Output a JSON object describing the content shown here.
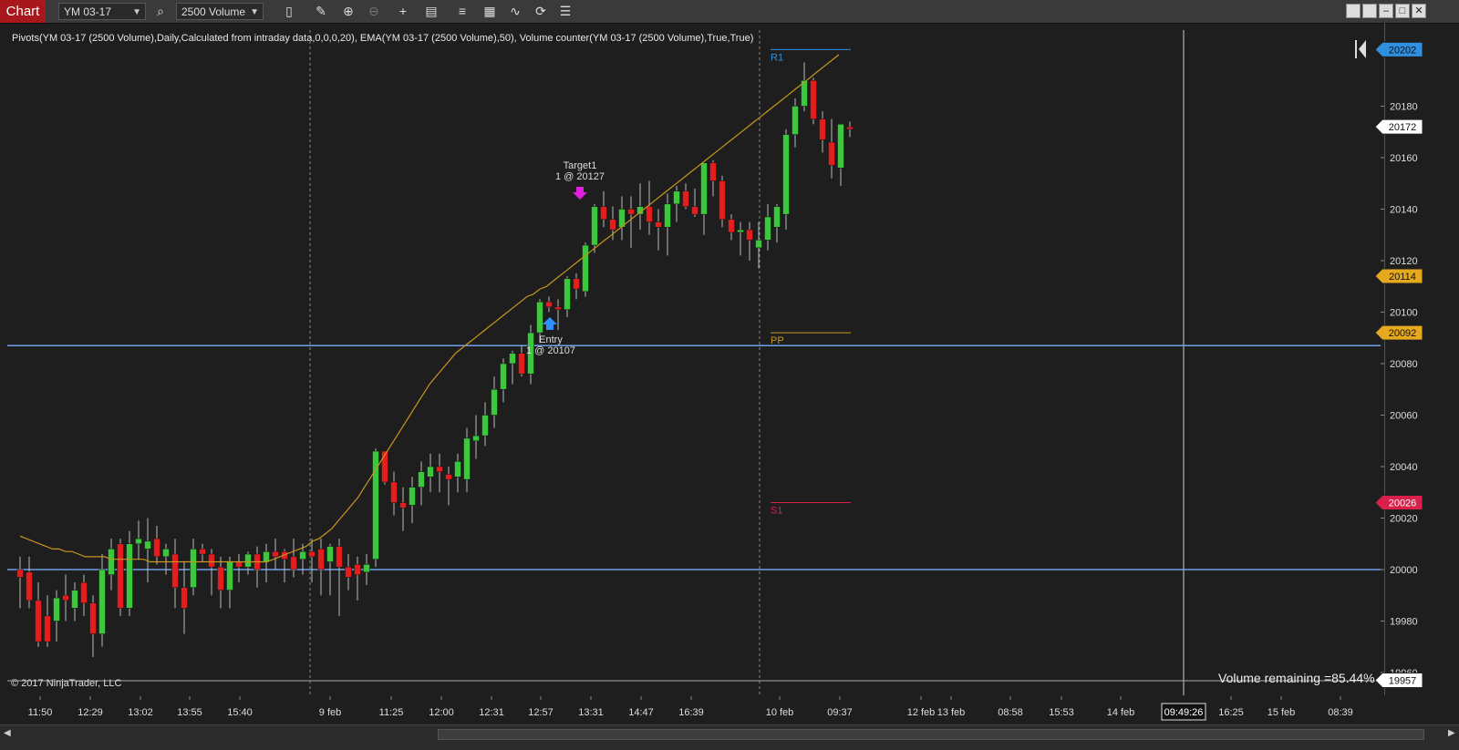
{
  "toolbar": {
    "chart_tab": "Chart",
    "instrument": "YM 03-17",
    "bar_type": "2500 Volume"
  },
  "indicator_label": "Pivots(YM 03-17 (2500 Volume),Daily,Calculated from intraday data,0,0,0,20), EMA(YM 03-17 (2500 Volume),50), Volume counter(YM 03-17 (2500 Volume),True,True)",
  "copyright": "© 2017 NinjaTrader, LLC",
  "volume_remaining": "Volume remaining =85.44%",
  "pivots": {
    "r1": "R1",
    "pp": "PP",
    "s1": "S1"
  },
  "annotations": {
    "target_title": "Target1",
    "target_detail": "1 @ 20127",
    "entry_title": "Entry",
    "entry_detail": "1 @ 20107"
  },
  "colors": {
    "up_candle": "#3cc83c",
    "down_candle": "#e41e1e",
    "ema": "#c8961e",
    "r1": "#2f8fe0",
    "pp": "#c8961e",
    "s1": "#d8204a",
    "hline": "#6fa0e8"
  },
  "chart_data": {
    "type": "candlestick",
    "y_ticks": [
      19960,
      19980,
      20000,
      20020,
      20040,
      20060,
      20080,
      20100,
      20120,
      20140,
      20160,
      20180
    ],
    "price_tags": [
      {
        "label": "20202",
        "color": "#2f8fe0"
      },
      {
        "label": "20172",
        "color": "#ffffff"
      },
      {
        "label": "20114",
        "color": "#e6a81c"
      },
      {
        "label": "20092",
        "color": "#e6a81c"
      },
      {
        "label": "20026",
        "color": "#d8204a"
      },
      {
        "label": "19957",
        "color": "#ffffff"
      }
    ],
    "x_ticks": [
      "11:50",
      "12:29",
      "13:02",
      "13:55",
      "15:40",
      "9 feb",
      "11:25",
      "12:00",
      "12:31",
      "12:57",
      "13:31",
      "14:47",
      "16:39",
      "10 feb",
      "09:37",
      "12 feb",
      "13 feb",
      "08:58",
      "15:53",
      "14 feb",
      "09:49:26",
      "16:25",
      "15 feb",
      "08:39"
    ],
    "highlighted_x_tick": "09:49:26",
    "horizontal_lines": [
      20087,
      20000
    ],
    "pivot_levels": {
      "r1": 20202,
      "pp": 20092,
      "s1": 20026
    },
    "candles": [
      [
        20000,
        20005,
        19985,
        19997
      ],
      [
        19999,
        20005,
        19985,
        19988
      ],
      [
        19988,
        19995,
        19970,
        19972
      ],
      [
        19982,
        19990,
        19970,
        19972
      ],
      [
        19980,
        19992,
        19972,
        19989
      ],
      [
        19990,
        19998,
        19980,
        19988
      ],
      [
        19985,
        19995,
        19980,
        19992
      ],
      [
        19995,
        19998,
        19982,
        19987
      ],
      [
        19987,
        19990,
        19966,
        19975
      ],
      [
        19975,
        20006,
        19970,
        20000
      ],
      [
        19998,
        20012,
        19992,
        20008
      ],
      [
        20010,
        20012,
        19982,
        19985
      ],
      [
        19985,
        20015,
        19982,
        20010
      ],
      [
        20010,
        20019,
        20004,
        20012
      ],
      [
        20008,
        20020,
        19995,
        20011
      ],
      [
        20012,
        20017,
        20002,
        20005
      ],
      [
        20005,
        20010,
        19998,
        20008
      ],
      [
        20006,
        20012,
        19985,
        19993
      ],
      [
        19993,
        20003,
        19975,
        19985
      ],
      [
        19993,
        20012,
        19990,
        20008
      ],
      [
        20008,
        20010,
        20003,
        20006
      ],
      [
        20006,
        20008,
        19990,
        20001
      ],
      [
        20001,
        20005,
        19985,
        19992
      ],
      [
        19992,
        20005,
        19985,
        20003
      ],
      [
        20003,
        20006,
        19995,
        20001
      ],
      [
        20001,
        20007,
        19998,
        20006
      ],
      [
        20006,
        20009,
        19993,
        20000
      ],
      [
        20003,
        20010,
        19995,
        20007
      ],
      [
        20007,
        20012,
        20000,
        20005
      ],
      [
        20007,
        20008,
        19995,
        20004
      ],
      [
        20005,
        20012,
        19997,
        20000
      ],
      [
        20004,
        20010,
        19998,
        20007
      ],
      [
        20007,
        20012,
        19995,
        20005
      ],
      [
        20008,
        20012,
        19990,
        20000
      ],
      [
        20003,
        20010,
        19990,
        20009
      ],
      [
        20009,
        20012,
        19982,
        20001
      ],
      [
        20001,
        20006,
        19992,
        19997
      ],
      [
        20002,
        20005,
        19988,
        19998
      ],
      [
        19999,
        20006,
        19994,
        20002
      ],
      [
        20004,
        20047,
        20001,
        20046
      ],
      [
        20046,
        20046,
        20033,
        20034
      ],
      [
        20034,
        20038,
        20021,
        20026
      ],
      [
        20026,
        20032,
        20015,
        20024
      ],
      [
        20025,
        20036,
        20018,
        20032
      ],
      [
        20032,
        20042,
        20025,
        20038
      ],
      [
        20036,
        20045,
        20030,
        20040
      ],
      [
        20040,
        20045,
        20030,
        20038
      ],
      [
        20037,
        20040,
        20025,
        20035
      ],
      [
        20036,
        20045,
        20030,
        20042
      ],
      [
        20035,
        20055,
        20030,
        20051
      ],
      [
        20050,
        20060,
        20043,
        20052
      ],
      [
        20052,
        20065,
        20048,
        20060
      ],
      [
        20060,
        20075,
        20055,
        20070
      ],
      [
        20070,
        20082,
        20065,
        20080
      ],
      [
        20080,
        20085,
        20072,
        20084
      ],
      [
        20084,
        20087,
        20075,
        20076
      ],
      [
        20076,
        20095,
        20072,
        20092
      ],
      [
        20092,
        20105,
        20088,
        20104
      ],
      [
        20104,
        20106,
        20100,
        20102
      ],
      [
        20102,
        20105,
        20093,
        20101
      ],
      [
        20101,
        20114,
        20098,
        20113
      ],
      [
        20113,
        20115,
        20105,
        20109
      ],
      [
        20108,
        20127,
        20106,
        20126
      ],
      [
        20126,
        20142,
        20123,
        20141
      ],
      [
        20141,
        20147,
        20133,
        20136
      ],
      [
        20136,
        20141,
        20128,
        20132
      ],
      [
        20133,
        20145,
        20128,
        20140
      ],
      [
        20140,
        20145,
        20125,
        20138
      ],
      [
        20138,
        20150,
        20132,
        20141
      ],
      [
        20141,
        20151,
        20130,
        20135
      ],
      [
        20135,
        20140,
        20124,
        20133
      ],
      [
        20133,
        20146,
        20122,
        20142
      ],
      [
        20142,
        20149,
        20135,
        20147
      ],
      [
        20147,
        20150,
        20140,
        20141
      ],
      [
        20141,
        20148,
        20137,
        20138
      ],
      [
        20138,
        20158,
        20130,
        20158
      ],
      [
        20158,
        20159,
        20145,
        20151
      ],
      [
        20151,
        20153,
        20133,
        20136
      ],
      [
        20136,
        20138,
        20128,
        20131
      ],
      [
        20131,
        20135,
        20122,
        20132
      ],
      [
        20132,
        20135,
        20120,
        20128
      ],
      [
        20125,
        20135,
        20117,
        20128
      ],
      [
        20128,
        20142,
        20124,
        20137
      ],
      [
        20133,
        20142,
        20127,
        20141
      ],
      [
        20138,
        20171,
        20132,
        20169
      ],
      [
        20169,
        20183,
        20164,
        20180
      ],
      [
        20180,
        20197,
        20178,
        20190
      ],
      [
        20190,
        20191,
        20173,
        20175
      ],
      [
        20175,
        20178,
        20162,
        20167
      ],
      [
        20166,
        20175,
        20152,
        20157
      ],
      [
        20156,
        20173,
        20149,
        20173
      ],
      [
        20172,
        20174,
        20168,
        20171
      ]
    ],
    "ema": [
      20013,
      20012,
      20011,
      20010,
      20009,
      20008,
      20008,
      20007,
      20007,
      20006,
      20005,
      20005,
      20005,
      20005,
      20004,
      20004,
      20004,
      20004,
      20004,
      20004,
      20003,
      20003,
      20003,
      20003,
      20003,
      20003,
      20003,
      20003,
      20003,
      20003,
      20003,
      20003,
      20003,
      20003,
      20003,
      20003,
      20003,
      20003,
      20003,
      20004,
      20005,
      20006,
      20007,
      20008,
      20009,
      20011,
      20012,
      20014,
      20016,
      20019,
      20022,
      20025,
      20028,
      20032,
      20036,
      20040,
      20044,
      20048,
      20052,
      20056,
      20060,
      20064,
      20068,
      20072,
      20075,
      20078,
      20081,
      20084,
      20086,
      20088,
      20090,
      20092,
      20094,
      20096,
      20098,
      20100,
      20102,
      20104,
      20106,
      20107,
      20109,
      20110,
      20112,
      20114,
      20116,
      20118,
      20120,
      20122,
      20124,
      20126,
      20128,
      20130,
      20132,
      20134,
      20136,
      20138,
      20140,
      20142,
      20144,
      20146,
      20148,
      20150,
      20152,
      20154,
      20156,
      20158,
      20160,
      20162,
      20164,
      20166,
      20168,
      20170,
      20172,
      20174,
      20176,
      20178,
      20180,
      20182,
      20184,
      20186,
      20188,
      20190,
      20192,
      20194,
      20196,
      20198,
      20200
    ]
  }
}
